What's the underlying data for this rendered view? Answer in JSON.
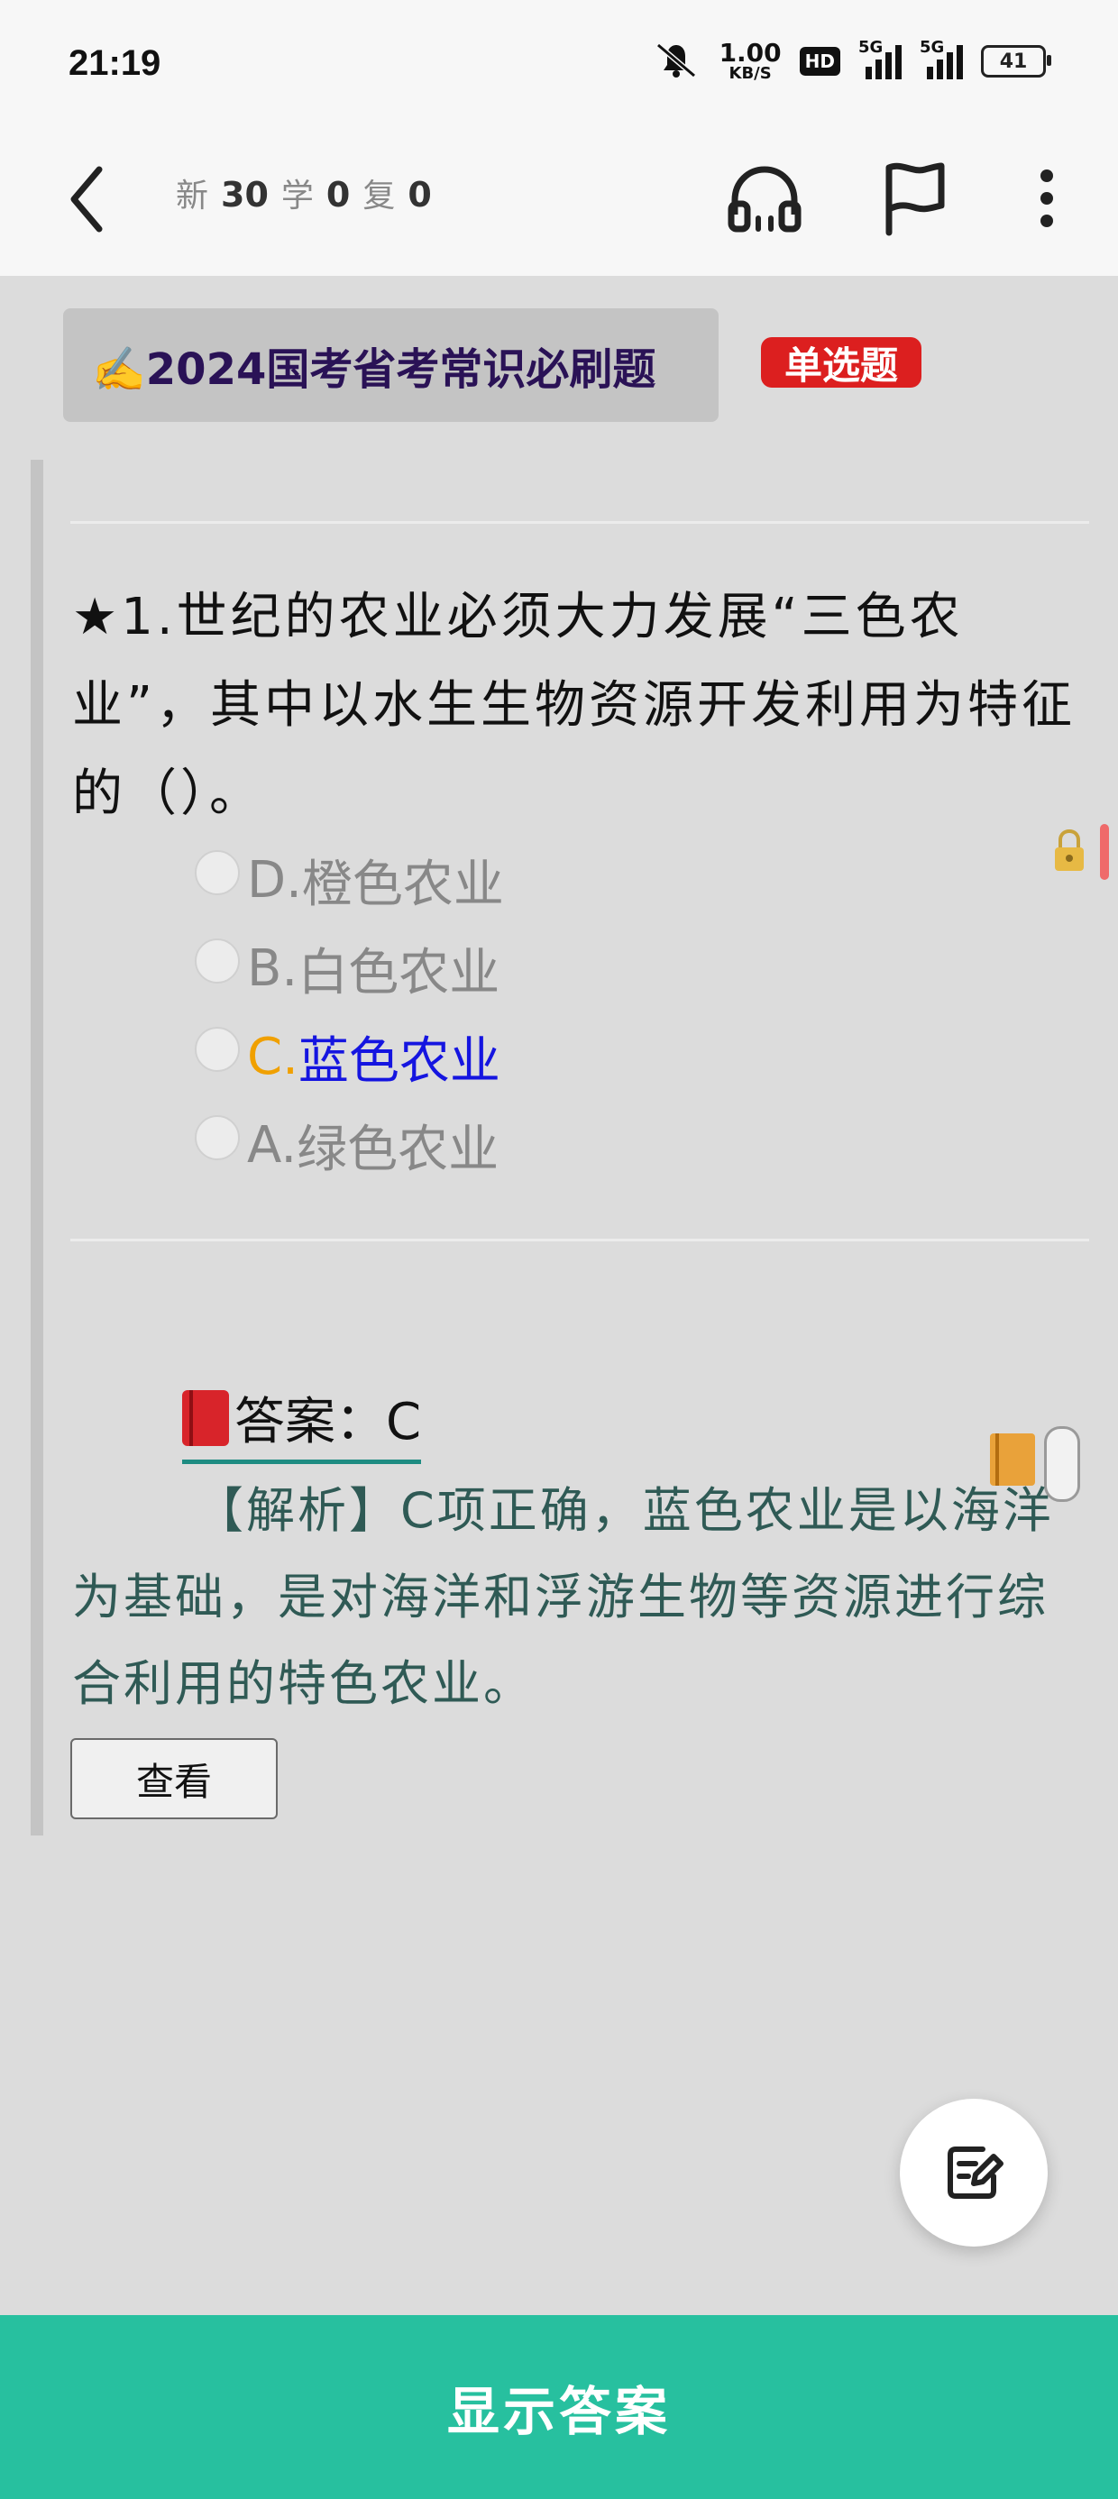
{
  "status_bar": {
    "time": "21:19",
    "net_speed_value": "1.00",
    "net_speed_unit": "KB/S",
    "hd_label": "HD",
    "signal1_label": "5G",
    "signal2_label": "5G",
    "battery": "41",
    "icons": [
      "mute-bell-icon",
      "hd-icon",
      "signal-5g-icon",
      "signal-5g-icon",
      "battery-icon"
    ]
  },
  "nav": {
    "new_label": "新",
    "new_count": "30",
    "learn_label": "学",
    "learn_count": "0",
    "review_label": "复",
    "review_count": "0",
    "icons": [
      "back-arrow-icon",
      "headphones-icon",
      "flag-icon",
      "more-vertical-icon"
    ]
  },
  "header": {
    "deck_title": "✍️2024国考省考常识必刷题",
    "question_type": "单选题"
  },
  "question": {
    "text": "★1.世纪的农业必须大力发展“三色农业”，其中以水生生物资源开发利用为特征的（）。",
    "options": [
      {
        "letter": "D.",
        "text": "橙色农业",
        "state": "normal"
      },
      {
        "letter": "B.",
        "text": "白色农业",
        "state": "normal"
      },
      {
        "letter": "C.",
        "text": "蓝色农业",
        "state": "correct"
      },
      {
        "letter": "A.",
        "text": "绿色农业",
        "state": "normal"
      }
    ]
  },
  "answer": {
    "label": "答案：C",
    "analysis": "【解析】C项正确，蓝色农业是以海洋为基础，是对海洋和浮游生物等资源进行综合利用的特色农业。",
    "view_button": "查看"
  },
  "bottom": {
    "show_answer": "显示答案"
  },
  "colors": {
    "accent_green": "#27c09f",
    "badge_red": "#dc1f1f",
    "correct_letter": "#f0a000",
    "correct_text": "#1515e0",
    "analysis_text": "#2f5a55"
  }
}
